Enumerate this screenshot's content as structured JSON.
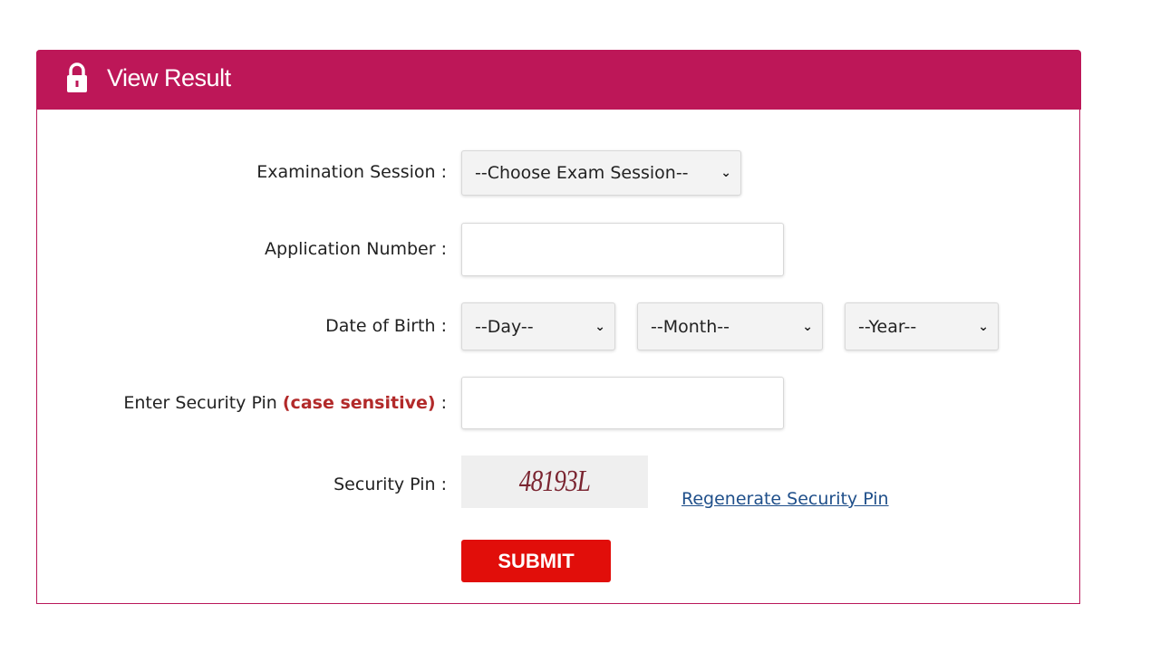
{
  "header": {
    "title": "View Result",
    "icon": "lock-icon",
    "color": "#bd1758"
  },
  "form": {
    "exam_session": {
      "label": "Examination Session :",
      "selected": "--Choose Exam Session--"
    },
    "application_number": {
      "label": "Application Number :",
      "value": ""
    },
    "dob": {
      "label": "Date of Birth :",
      "day": "--Day--",
      "month": "--Month--",
      "year": "--Year--"
    },
    "security_pin_input": {
      "label": "Enter Security Pin",
      "note": "(case sensitive)",
      "colon": ":",
      "value": ""
    },
    "security_pin": {
      "label": "Security Pin :",
      "captcha": "48193L"
    },
    "regenerate_label": "Regenerate Security Pin",
    "submit_label": "SUBMIT"
  }
}
